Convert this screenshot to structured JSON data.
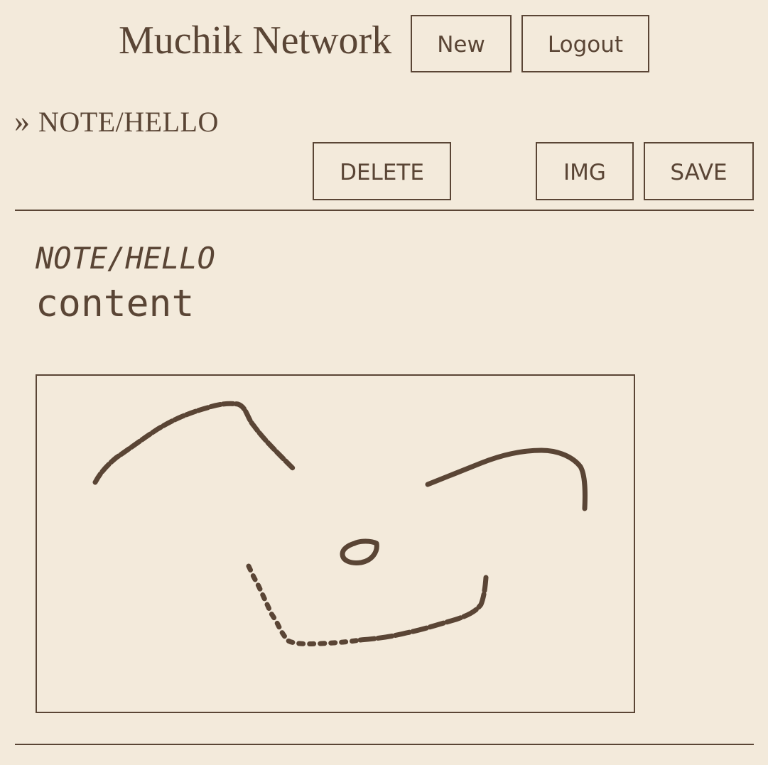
{
  "header": {
    "brand": "Muchik Network",
    "new_label": "New",
    "logout_label": "Logout"
  },
  "breadcrumb": {
    "chevron": "»",
    "path": "NOTE/HELLO"
  },
  "toolbar": {
    "delete_label": "DELETE",
    "img_label": "IMG",
    "save_label": "SAVE"
  },
  "note": {
    "title": "NOTE/HELLO",
    "body": "content"
  },
  "colors": {
    "background": "#f3eadb",
    "ink": "#5a4535"
  }
}
